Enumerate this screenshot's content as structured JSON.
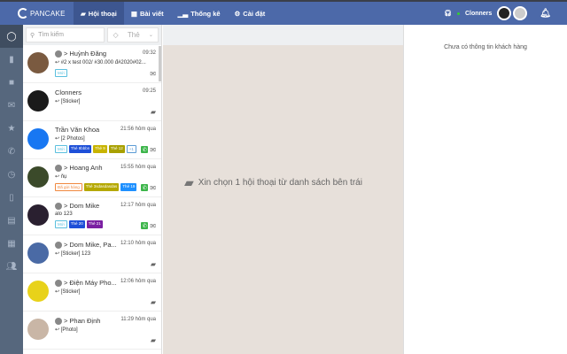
{
  "header": {
    "logo": "PANCAKE",
    "tabs": [
      {
        "label": "Hội thoại",
        "active": true
      },
      {
        "label": "Bài viết"
      },
      {
        "label": "Thống kê"
      },
      {
        "label": "Cài đặt"
      }
    ],
    "page_name": "Clonners"
  },
  "search": {
    "placeholder": "Tìm kiếm",
    "tag_filter": "Thẻ"
  },
  "conversations": [
    {
      "name": "Huỳnh Đăng",
      "time": "09:32",
      "msg": "↩ #2 x test 002/ #30.000 đ#2020#02...",
      "tags": [
        {
          "t": "Mới",
          "c": "#fff",
          "o": "#5bc0de"
        }
      ],
      "icons": "✉",
      "color": "#7a5a40"
    },
    {
      "name": "Clonners",
      "time": "09:25",
      "msg": "↩ [Sticker]",
      "tags": [],
      "icons": "💬",
      "color": "#1a1a1a"
    },
    {
      "name": "Trần Văn Khoa",
      "time": "21:56 hôm qua",
      "msg": "↩ [2 Photos]",
      "tags": [
        {
          "t": "Mới",
          "c": "#fff",
          "o": "#5bc0de"
        },
        {
          "t": "Thẻ 8bbbn",
          "c": "#1d4fd8"
        },
        {
          "t": "Thẻ 9",
          "c": "#c8b400"
        },
        {
          "t": "Thẻ 12",
          "c": "#a8a000"
        },
        {
          "t": "+1",
          "c": "#fff",
          "o": "#5b9bd5"
        }
      ],
      "icons": "✉",
      "phone": true,
      "color": "#1877f2"
    },
    {
      "name": "Hoang Anh",
      "time": "15:55 hôm qua",
      "msg": "↩ ňụ",
      "tags": [
        {
          "t": "Đã gửi hàng",
          "c": "#fff",
          "o": "#f0883e"
        },
        {
          "t": "Thẻ 3sdasdasdas",
          "c": "#b5a800"
        },
        {
          "t": "Thẻ 19",
          "c": "#1e90ff"
        }
      ],
      "icons": "✉",
      "phone": true,
      "color": "#3b4a2a"
    },
    {
      "name": "Dom Mike",
      "time": "12:17 hôm qua",
      "msg": "alo 123",
      "tags": [
        {
          "t": "Mới",
          "c": "#fff",
          "o": "#5bc0de"
        },
        {
          "t": "Thẻ 20",
          "c": "#1d4fd8"
        },
        {
          "t": "Thẻ 21",
          "c": "#7b1fa2"
        }
      ],
      "icons": "✉",
      "phone": true,
      "color": "#2a2030"
    },
    {
      "name": "Dom Mike, Pa...",
      "time": "12:10 hôm qua",
      "msg": "↩ [Sticker] 123",
      "tags": [],
      "icons": "💬",
      "color": "#4a6aa5"
    },
    {
      "name": "Điện Máy Pho...",
      "time": "12:06 hôm qua",
      "msg": "↩ [Sticker]",
      "tags": [],
      "icons": "💬",
      "color": "#e8d21a"
    },
    {
      "name": "Phan Định",
      "time": "11:29 hôm qua",
      "msg": "↩ [Photo]",
      "tags": [],
      "icons": "💬",
      "color": "#c9b6a6"
    }
  ],
  "main": {
    "empty_text": "Xin chọn 1 hội thoại từ danh sách bên trái"
  },
  "customer": {
    "empty_text": "Chưa có thông tin khách hàng"
  }
}
